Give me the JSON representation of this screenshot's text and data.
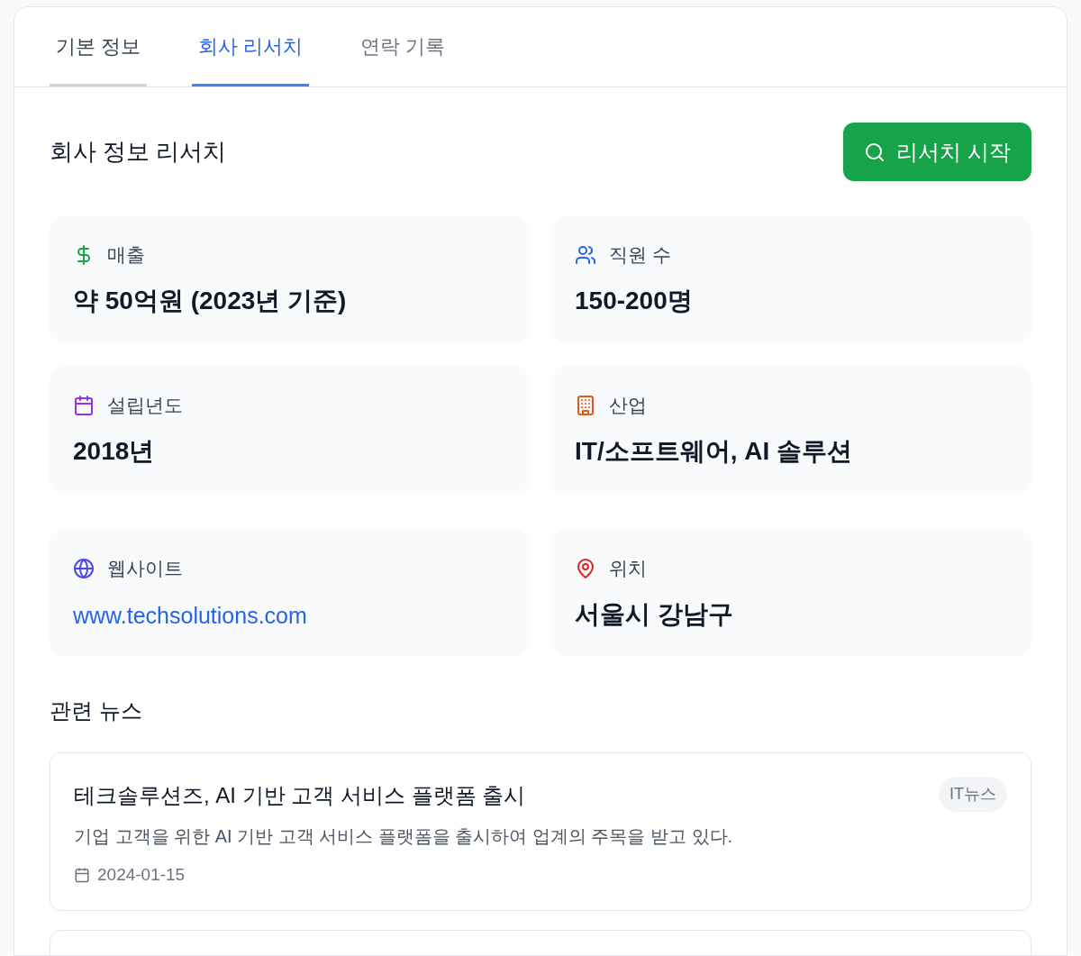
{
  "tabs": [
    {
      "label": "기본 정보",
      "selected": false,
      "hovered": true
    },
    {
      "label": "회사 리서치",
      "selected": true,
      "hovered": false
    },
    {
      "label": "연락 기록",
      "selected": false,
      "hovered": false
    }
  ],
  "research": {
    "title": "회사 정보 리서치",
    "button": "리서치 시작",
    "facts": [
      {
        "label": "매출",
        "value": "약 50억원 (2023년 기준)",
        "kind": "text"
      },
      {
        "label": "직원 수",
        "value": "150-200명",
        "kind": "text"
      },
      {
        "label": "설립년도",
        "value": "2018년",
        "kind": "text"
      },
      {
        "label": "산업",
        "value": "IT/소프트웨어, AI 솔루션",
        "kind": "text"
      }
    ],
    "contacts": [
      {
        "label": "웹사이트",
        "value": "www.techsolutions.com",
        "kind": "link"
      },
      {
        "label": "위치",
        "value": "서울시 강남구",
        "kind": "text"
      }
    ]
  },
  "news": {
    "title": "관련 뉴스",
    "items": [
      {
        "title": "테크솔루션즈, AI 기반 고객 서비스 플랫폼 출시",
        "tag": "IT뉴스",
        "summary": "기업 고객을 위한 AI 기반 고객 서비스 플랫폼을 출시하여 업계의 주목을 받고 있다.",
        "date": "2024-01-15"
      }
    ]
  }
}
